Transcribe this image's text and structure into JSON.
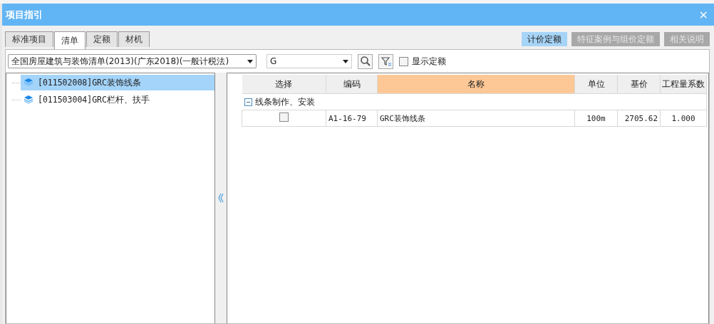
{
  "window": {
    "title": "项目指引",
    "close": "×"
  },
  "tabs": [
    {
      "label": "标准项目",
      "selected": false
    },
    {
      "label": "清单",
      "selected": true
    },
    {
      "label": "定额",
      "selected": false
    },
    {
      "label": "材机",
      "selected": false
    }
  ],
  "view_buttons": [
    {
      "label": "计价定额",
      "selected": true
    },
    {
      "label": "特征案例与组价定额",
      "selected": false
    },
    {
      "label": "相关说明",
      "selected": false
    }
  ],
  "library_select": {
    "value": "全国房屋建筑与装饰清单(2013)(广东2018)(一般计税法)"
  },
  "search": {
    "value": "G"
  },
  "show_quota": {
    "label": "显示定额",
    "checked": false
  },
  "tree": [
    {
      "label": "[011502008]GRC装饰线条",
      "selected": true
    },
    {
      "label": "[011503004]GRC栏杆、扶手",
      "selected": false
    }
  ],
  "table": {
    "columns": [
      {
        "label": "选择",
        "highlighted": false
      },
      {
        "label": "编码",
        "highlighted": false
      },
      {
        "label": "名称",
        "highlighted": true
      },
      {
        "label": "单位",
        "highlighted": false
      },
      {
        "label": "基价",
        "highlighted": false
      },
      {
        "label": "工程量系数",
        "highlighted": false
      }
    ],
    "groups": [
      {
        "label": "线条制作、安装",
        "expanded": true,
        "rows": [
          {
            "checked": false,
            "code": "A1-16-79",
            "name": "GRC装饰线条",
            "unit": "100m",
            "price": "2705.62",
            "factor": "1.000"
          }
        ]
      }
    ]
  }
}
